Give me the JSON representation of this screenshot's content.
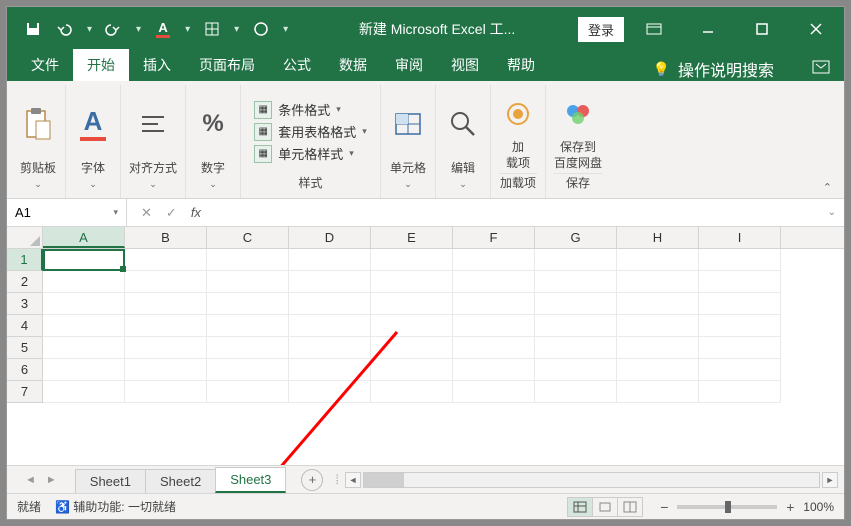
{
  "title": "新建 Microsoft Excel 工...",
  "login": "登录",
  "tabs": [
    "文件",
    "开始",
    "插入",
    "页面布局",
    "公式",
    "数据",
    "审阅",
    "视图",
    "帮助"
  ],
  "active_tab": "开始",
  "tell_me": "操作说明搜索",
  "ribbon": {
    "clipboard": "剪贴板",
    "font": "字体",
    "align": "对齐方式",
    "number": "数字",
    "styles": "样式",
    "cond_format": "条件格式",
    "table_format": "套用表格格式",
    "cell_styles": "单元格样式",
    "cells": "单元格",
    "editing": "编辑",
    "addins": "加载项",
    "addins_label": "加\n载项",
    "save_to": "保存到\n百度网盘",
    "save_group": "保存"
  },
  "name_box": "A1",
  "columns": [
    "A",
    "B",
    "C",
    "D",
    "E",
    "F",
    "G",
    "H",
    "I"
  ],
  "rows": [
    "1",
    "2",
    "3",
    "4",
    "5",
    "6",
    "7"
  ],
  "active_cell": "A1",
  "sheets": [
    "Sheet1",
    "Sheet2",
    "Sheet3"
  ],
  "active_sheet": "Sheet3",
  "status": {
    "ready": "就绪",
    "accessibility": "辅助功能: 一切就绪",
    "zoom": "100%"
  }
}
